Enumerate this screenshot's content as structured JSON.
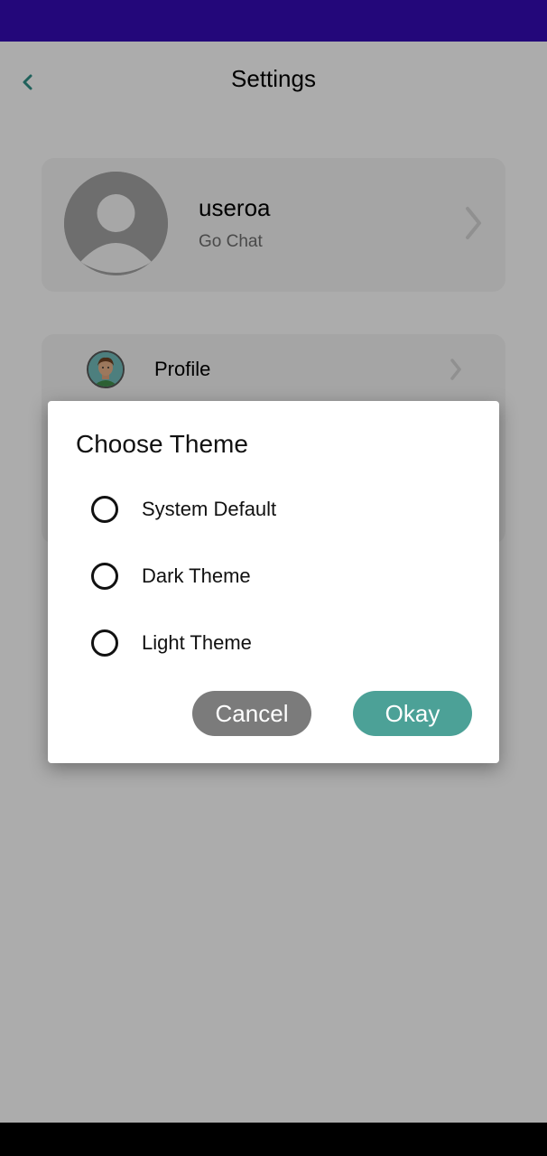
{
  "header": {
    "title": "Settings",
    "back_icon": "chevron-left-icon"
  },
  "user_card": {
    "name": "useroa",
    "subtitle": "Go Chat",
    "avatar_icon": "user-avatar-icon",
    "chevron_icon": "chevron-right-icon"
  },
  "list": {
    "profile_label": "Profile",
    "profile_icon": "man-avatar-icon",
    "chevron_icon": "chevron-right-icon"
  },
  "dialog": {
    "title": "Choose Theme",
    "options": [
      {
        "label": "System Default",
        "selected": false
      },
      {
        "label": "Dark Theme",
        "selected": false
      },
      {
        "label": "Light Theme",
        "selected": false
      }
    ],
    "cancel_label": "Cancel",
    "okay_label": "Okay"
  },
  "colors": {
    "status_bar": "#23077a",
    "accent": "#4ca197",
    "cancel": "#7b7b7b",
    "back_arrow": "#2e8b83"
  }
}
